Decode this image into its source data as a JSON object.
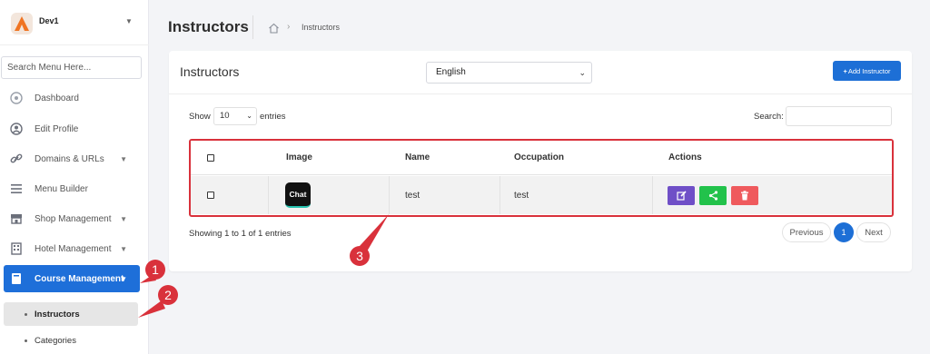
{
  "brand": {
    "name": "Dev1"
  },
  "sidebar": {
    "search_placeholder": "Search Menu Here...",
    "items": [
      {
        "label": "Dashboard",
        "icon": "dashboard-icon"
      },
      {
        "label": "Edit Profile",
        "icon": "user-circle-icon"
      },
      {
        "label": "Domains & URLs",
        "icon": "link-icon"
      },
      {
        "label": "Menu Builder",
        "icon": "bars-icon"
      },
      {
        "label": "Shop Management",
        "icon": "store-icon"
      },
      {
        "label": "Hotel Management",
        "icon": "building-icon"
      },
      {
        "label": "Course Management",
        "icon": "book-icon"
      }
    ],
    "sub_items": [
      {
        "label": "Instructors"
      },
      {
        "label": "Categories"
      }
    ]
  },
  "header": {
    "title": "Instructors",
    "breadcrumb_current": "Instructors"
  },
  "card": {
    "title": "Instructors",
    "language": "English",
    "add_button": "Add Instructor",
    "show_label": "Show",
    "entries_value": "10",
    "entries_label": "entries",
    "search_label": "Search:"
  },
  "table": {
    "columns": [
      "Image",
      "Name",
      "Occupation",
      "Actions"
    ],
    "rows": [
      {
        "image_text": "Chat",
        "name": "test",
        "occupation": "test"
      }
    ]
  },
  "footer": {
    "showing": "Showing 1 to 1 of 1 entries",
    "previous": "Previous",
    "page": "1",
    "next": "Next"
  },
  "callouts": [
    "1",
    "2",
    "3"
  ],
  "colors": {
    "primary": "#1d6fd6",
    "edit": "#6f4fc7",
    "share": "#22c24b",
    "delete": "#ef5a5d",
    "annotation": "#d9313b"
  }
}
